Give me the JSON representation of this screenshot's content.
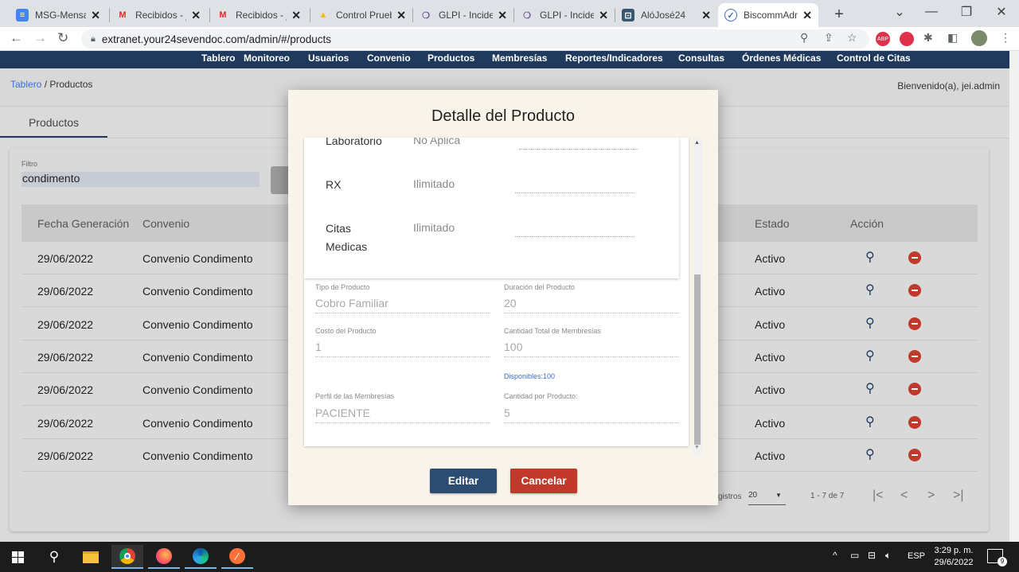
{
  "browser": {
    "tabs": [
      {
        "title": "MSG-Mensaje",
        "icon": "docs-icon"
      },
      {
        "title": "Recibidos - je",
        "icon": "gmail-icon"
      },
      {
        "title": "Recibidos - je",
        "icon": "gmail-icon"
      },
      {
        "title": "Control Prueb",
        "icon": "drive-icon"
      },
      {
        "title": "GLPI - Inciden",
        "icon": "glpi-icon"
      },
      {
        "title": "GLPI - Inciden",
        "icon": "glpi-icon"
      },
      {
        "title": "AlóJosé24",
        "icon": "alojose-icon"
      },
      {
        "title": "BiscommAdmi",
        "icon": "biscomm-icon"
      }
    ],
    "url": "extranet.your24sevendoc.com/admin/#/products"
  },
  "nav": {
    "items": [
      "Tablero",
      "Monitoreo",
      "Usuarios",
      "Convenio",
      "Productos",
      "Membresías",
      "Reportes/Indicadores",
      "Consultas",
      "Órdenes Médicas",
      "Control de Citas"
    ]
  },
  "breadcrumb": {
    "home": "Tablero",
    "separator": " / ",
    "current": "Productos"
  },
  "welcome": "Bienvenido(a), jei.admin",
  "page_tab": "Productos",
  "filter": {
    "label": "Filtro",
    "value": "condimento"
  },
  "table": {
    "headers": {
      "fecha": "Fecha Generación",
      "convenio": "Convenio",
      "estado": "Estado",
      "accion": "Acción"
    },
    "rows": [
      {
        "fecha": "29/06/2022",
        "convenio": "Convenio Condimento",
        "estado": "Activo"
      },
      {
        "fecha": "29/06/2022",
        "convenio": "Convenio Condimento",
        "estado": "Activo"
      },
      {
        "fecha": "29/06/2022",
        "convenio": "Convenio Condimento",
        "estado": "Activo"
      },
      {
        "fecha": "29/06/2022",
        "convenio": "Convenio Condimento",
        "estado": "Activo"
      },
      {
        "fecha": "29/06/2022",
        "convenio": "Convenio Condimento",
        "estado": "Activo"
      },
      {
        "fecha": "29/06/2022",
        "convenio": "Convenio Condimento",
        "estado": "Activo"
      },
      {
        "fecha": "29/06/2022",
        "convenio": "Convenio Condimento",
        "estado": "Activo"
      }
    ]
  },
  "pagination": {
    "registros_label": "gistros",
    "page_size": "20",
    "range": "1 - 7 de 7"
  },
  "modal": {
    "title": "Detalle del Producto",
    "services": [
      {
        "name": "Laboratorio",
        "value": "No Aplica"
      },
      {
        "name": "RX",
        "value": "Ilimitado"
      },
      {
        "name": "Citas Medicas",
        "value": "Ilimitado"
      }
    ],
    "fields": {
      "tipo_label": "Tipo de Producto",
      "tipo_value": "Cobro Familiar",
      "duracion_label": "Duración del Producto",
      "duracion_value": "20",
      "costo_label": "Costo del Producto",
      "costo_value": "1",
      "cantidad_total_label": "Cantidad Total de Membresías",
      "cantidad_total_value": "100",
      "disponibles": "Disponibles:100",
      "perfil_label": "Perfil de las Membresías",
      "perfil_value": "PACIENTE",
      "cantidad_producto_label": "Cantidad por Producto:",
      "cantidad_producto_value": "5"
    },
    "edit_label": "Editar",
    "cancel_label": "Cancelar"
  },
  "taskbar": {
    "lang": "ESP",
    "time": "3:29 p. m.",
    "date": "29/6/2022",
    "notif_count": "9"
  },
  "colors": {
    "navbar": "#1f3a5c",
    "edit": "#2b4d72",
    "cancel": "#c0392b",
    "link": "#3b6fd1",
    "delete": "#c0392b"
  }
}
